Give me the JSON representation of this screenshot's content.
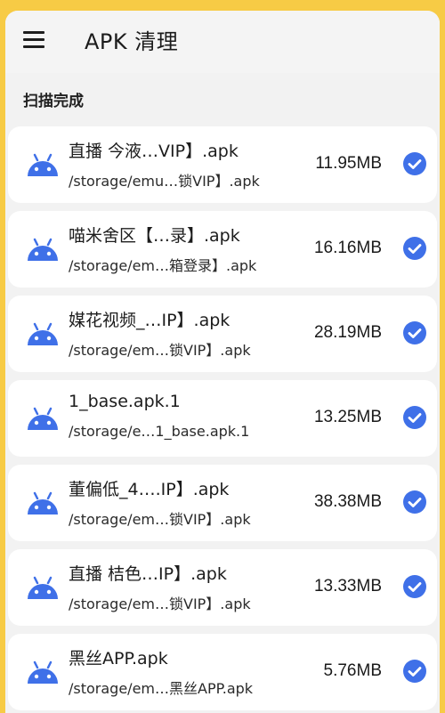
{
  "header": {
    "title": "APK 清理",
    "menu_icon": "hamburger-icon"
  },
  "section_title": "扫描完成",
  "colors": {
    "background": "#f7cb45",
    "check": "#3f70e8",
    "android": "#3f70e8"
  },
  "items": [
    {
      "name": "直播 今液…VIP】.apk",
      "path": "/storage/emu…锁VIP】.apk",
      "size": "11.95MB",
      "checked": true
    },
    {
      "name": "喵米舍区【…录】.apk",
      "path": "/storage/em…箱登录】.apk",
      "size": "16.16MB",
      "checked": true
    },
    {
      "name": "媒花视频_…IP】.apk",
      "path": "/storage/em…锁VIP】.apk",
      "size": "28.19MB",
      "checked": true
    },
    {
      "name": "1_base.apk.1",
      "path": "/storage/e…1_base.apk.1",
      "size": "13.25MB",
      "checked": true
    },
    {
      "name": "董偏低_4….IP】.apk",
      "path": "/storage/em…锁VIP】.apk",
      "size": "38.38MB",
      "checked": true
    },
    {
      "name": "直播 桔色…IP】.apk",
      "path": "/storage/em…锁VIP】.apk",
      "size": "13.33MB",
      "checked": true
    },
    {
      "name": "黑丝APP.apk",
      "path": "/storage/em…黑丝APP.apk",
      "size": "5.76MB",
      "checked": true
    }
  ]
}
